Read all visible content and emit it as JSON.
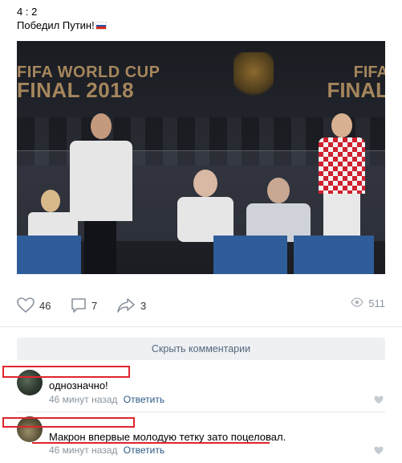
{
  "post": {
    "line1": "4 : 2",
    "line2": "Победил Путин!"
  },
  "photo": {
    "banner_left_small": "FIFA WORLD CUP",
    "banner_left_big": "FINAL 2018",
    "banner_right_small": "FIFA",
    "banner_right_big": "FINAL"
  },
  "actions": {
    "likes": "46",
    "comments": "7",
    "shares": "3",
    "views": "511"
  },
  "hide_comments_label": "Скрыть комментарии",
  "comments": [
    {
      "text": "однозначно!",
      "time": "46 минут назад",
      "reply": "Ответить"
    },
    {
      "text": "Макрон впервые молодую тетку зато поцеловал.",
      "time": "46 минут назад",
      "reply": "Ответить"
    }
  ],
  "colors": {
    "accent_link": "#2a5885",
    "meta_gray": "#8a949e",
    "redaction_red": "#e0252d"
  }
}
